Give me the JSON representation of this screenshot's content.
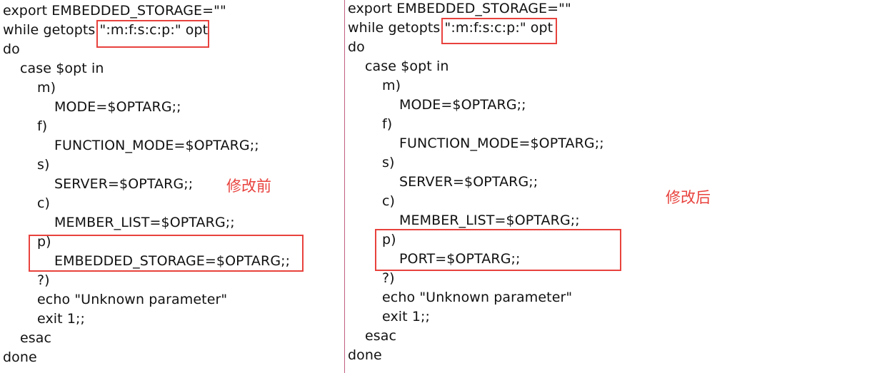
{
  "left": {
    "lines": [
      "export EMBEDDED_STORAGE=\"\"",
      "while getopts \":m:f:s:c:p:\" opt",
      "do",
      "case $opt in",
      "m)",
      "MODE=$OPTARG;;",
      "f)",
      "FUNCTION_MODE=$OPTARG;;",
      "s)",
      "SERVER=$OPTARG;;",
      "c)",
      "MEMBER_LIST=$OPTARG;;",
      "p)",
      "EMBEDDED_STORAGE=$OPTARG;;",
      "?)",
      "echo \"Unknown parameter\"",
      "exit 1;;",
      "esac",
      "done"
    ],
    "note": "修改前"
  },
  "right": {
    "lines": [
      "export EMBEDDED_STORAGE=\"\"",
      "while getopts \":m:f:s:c:p:\" opt",
      "do",
      "case $opt in",
      "m)",
      "MODE=$OPTARG;;",
      "f)",
      "FUNCTION_MODE=$OPTARG;;",
      "s)",
      "SERVER=$OPTARG;;",
      "c)",
      "MEMBER_LIST=$OPTARG;;",
      "p)",
      "PORT=$OPTARG;;",
      "?)",
      "echo \"Unknown parameter\"",
      "exit 1;;",
      "esac",
      "done"
    ],
    "note": "修改后"
  },
  "colors": {
    "highlight": "#e8423d",
    "divider": "#c06080",
    "text": "#111111"
  }
}
